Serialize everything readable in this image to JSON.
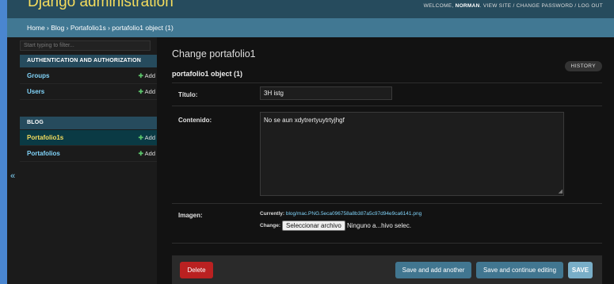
{
  "header": {
    "site_name": "Django administration",
    "welcome_prefix": "WELCOME, ",
    "user_name": "NORMAN",
    "welcome_suffix": ". ",
    "links": [
      "VIEW SITE",
      "CHANGE PASSWORD",
      "LOG OUT"
    ],
    "separator": " / "
  },
  "breadcrumbs": {
    "items": [
      "Home",
      "Blog",
      "Portafolio1s",
      "portafolio1 object (1)"
    ],
    "separator": " › "
  },
  "sidebar": {
    "filter_placeholder": "Start typing to filter...",
    "apps": [
      {
        "caption": "AUTHENTICATION AND AUTHORIZATION",
        "models": [
          {
            "label": "Groups",
            "add": "Add"
          },
          {
            "label": "Users",
            "add": "Add"
          }
        ]
      },
      {
        "caption": "BLOG",
        "models": [
          {
            "label": "Portafolio1s",
            "add": "Add",
            "active": true
          },
          {
            "label": "Portafolios",
            "add": "Add"
          }
        ]
      }
    ],
    "add_icon": "plus-icon",
    "toggle": "«"
  },
  "content": {
    "title": "Change portafolio1",
    "history_label": "HISTORY",
    "object_title": "portafolio1 object (1)",
    "fields": {
      "titulo": {
        "label": "Título:",
        "value": "3H istg"
      },
      "contenido": {
        "label": "Contenido:",
        "value": "No se aun xdytrertyuytrtyjhgf"
      },
      "imagen": {
        "label": "Imagen:",
        "currently_label": "Currently:",
        "currently_value": "blog/mac.PNG.5eca096758a8b387a5c97d94e9ca6141.png",
        "change_label": "Change:",
        "file_button": "Seleccionar archivo",
        "file_status": "Ninguno a...hivo selec."
      }
    }
  },
  "submit_row": {
    "delete": "Delete",
    "save_add_another": "Save and add another",
    "save_continue": "Save and continue editing",
    "save": "SAVE"
  },
  "colors": {
    "header_bg": "#264b5d",
    "branding": "#f5dd5d",
    "breadcrumbs_bg": "#417893",
    "link": "#81d4fa",
    "delete": "#ba2121",
    "button": "#417690",
    "save": "#79aec8"
  }
}
